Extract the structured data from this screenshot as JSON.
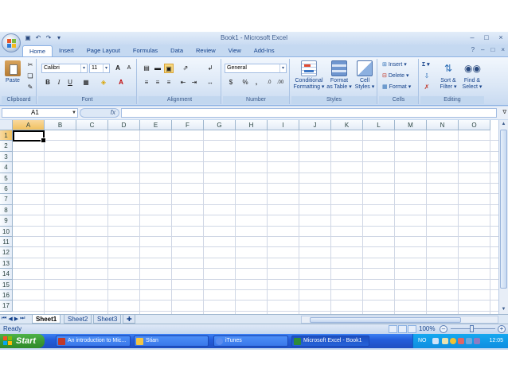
{
  "window": {
    "title": "Book1 - Microsoft Excel",
    "controls": [
      "–",
      "□",
      "×"
    ],
    "ribbon_controls": [
      "?",
      "–",
      "□",
      "×"
    ]
  },
  "quick_access": [
    "save-icon",
    "undo-icon",
    "redo-icon",
    "customize-icon"
  ],
  "tabs": [
    {
      "label": "Home",
      "active": true
    },
    {
      "label": "Insert",
      "active": false
    },
    {
      "label": "Page Layout",
      "active": false
    },
    {
      "label": "Formulas",
      "active": false
    },
    {
      "label": "Data",
      "active": false
    },
    {
      "label": "Review",
      "active": false
    },
    {
      "label": "View",
      "active": false
    },
    {
      "label": "Add-Ins",
      "active": false
    }
  ],
  "ribbon": {
    "clipboard": {
      "label": "Clipboard",
      "paste": "Paste"
    },
    "font": {
      "label": "Font",
      "family": "Calibri",
      "size": "11",
      "bold": "B",
      "italic": "I",
      "underline": "U",
      "grow": "A",
      "shrink": "A"
    },
    "alignment": {
      "label": "Alignment"
    },
    "number": {
      "label": "Number",
      "format": "General",
      "currency": "$",
      "percent": "%",
      "comma": ","
    },
    "styles": {
      "label": "Styles",
      "conditional_1": "Conditional",
      "conditional_2": "Formatting ▾",
      "table_1": "Format",
      "table_2": "as Table ▾",
      "cell_1": "Cell",
      "cell_2": "Styles ▾"
    },
    "cells": {
      "label": "Cells",
      "insert": "Insert ▾",
      "delete": "Delete ▾",
      "format": "Format ▾"
    },
    "editing": {
      "label": "Editing",
      "sigma": "Σ ▾",
      "sort_1": "Sort &",
      "sort_2": "Filter ▾",
      "find_1": "Find &",
      "find_2": "Select ▾"
    }
  },
  "formula_bar": {
    "name_box": "A1",
    "fx": "fx",
    "formula": ""
  },
  "grid": {
    "columns": [
      "A",
      "B",
      "C",
      "D",
      "E",
      "F",
      "G",
      "H",
      "I",
      "J",
      "K",
      "L",
      "M",
      "N",
      "O"
    ],
    "rows": [
      "1",
      "2",
      "3",
      "4",
      "5",
      "6",
      "7",
      "8",
      "9",
      "10",
      "11",
      "12",
      "13",
      "14",
      "15",
      "16",
      "17"
    ],
    "selected_cell": "A1"
  },
  "sheets": [
    {
      "label": "Sheet1",
      "active": true
    },
    {
      "label": "Sheet2",
      "active": false
    },
    {
      "label": "Sheet3",
      "active": false
    }
  ],
  "status": {
    "ready": "Ready",
    "zoom": "100%"
  },
  "taskbar": {
    "start": "Start",
    "items": [
      {
        "label": "An introduction to Mic...",
        "active": false,
        "icon_color": "#c0392b"
      },
      {
        "label": "Stian",
        "active": false,
        "icon_color": "#f4c542"
      },
      {
        "label": "iTunes",
        "active": false,
        "icon_color": "#5b8def"
      },
      {
        "label": "Microsoft Excel - Book1",
        "active": true,
        "icon_color": "#2e8b3a"
      }
    ],
    "language": "NO",
    "clock": "12:05"
  }
}
